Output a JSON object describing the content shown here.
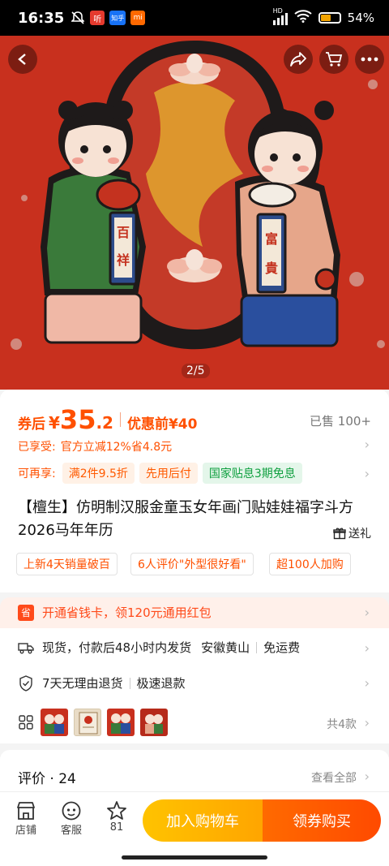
{
  "status_bar": {
    "time": "16:35",
    "app_icons": [
      "听",
      "知乎",
      "mi"
    ],
    "network": "HD",
    "battery": "54%",
    "battery_level": 0.54
  },
  "hero": {
    "pager": "2/5",
    "left_badge_chars": [
      "百",
      "祥"
    ],
    "right_badge_chars": [
      "富",
      "貴"
    ]
  },
  "colors": {
    "accent": "#ff5000",
    "hero_red": "#c8301e",
    "cart_button": "#ffb000",
    "buy_button": "#ff5500",
    "green_tag": "#10a040"
  },
  "price": {
    "label": "券后",
    "currency": "¥",
    "integer": "35",
    "decimal": ".2",
    "pre_discount": "优惠前¥40",
    "sold": "已售 100+"
  },
  "discount": {
    "label": "已享受:",
    "text": "官方立减12%省4.8元"
  },
  "promo": {
    "label": "可再享:",
    "tags": [
      "满2件9.5折",
      "先用后付",
      "国家贴息3期免息"
    ]
  },
  "product": {
    "title": "【檀生】仿明制汉服金童玉女年画门贴娃娃福字斗方2026马年年历",
    "gift": "送礼"
  },
  "highlights": [
    "上新4天销量破百",
    "6人评价\"外型很好看\"",
    "超100人加购"
  ],
  "savings_card": {
    "badge": "省",
    "text": "开通省钱卡，领120元通用红包"
  },
  "shipping": {
    "text": "现货，付款后48小时内发货",
    "origin": "安徽黄山",
    "fee": "免运费"
  },
  "guarantee": {
    "return": "7天无理由退货",
    "refund": "极速退款"
  },
  "variants": {
    "count": "共4款",
    "icon": "grid-icon"
  },
  "reviews": {
    "title": "评价 · 24",
    "view_all": "查看全部"
  },
  "bottom_bar": {
    "shop": "店铺",
    "service": "客服",
    "favorites": "81",
    "add_cart": "加入购物车",
    "buy": "领券购买"
  }
}
